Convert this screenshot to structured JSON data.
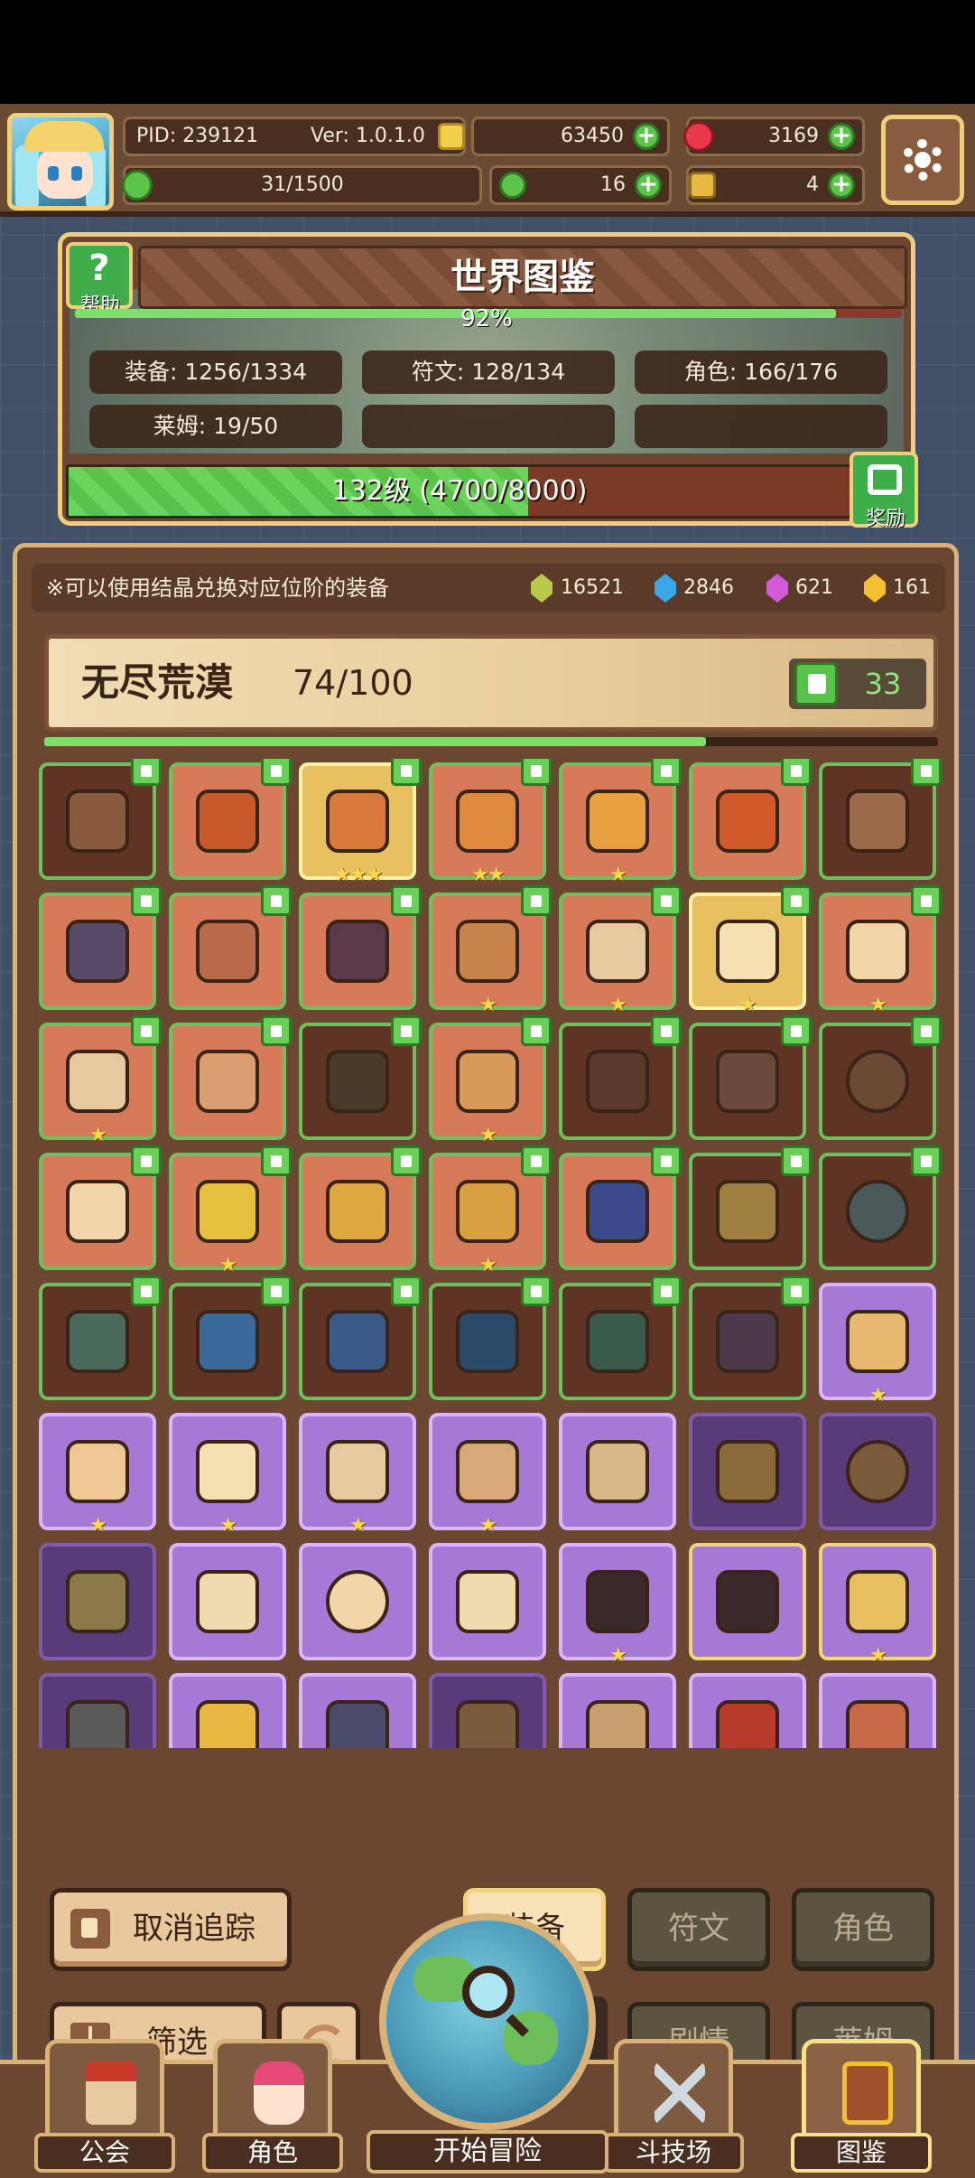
{
  "header": {
    "pid": "PID: 239121",
    "version": "Ver: 1.0.1.0",
    "gold": "63450",
    "ruby": "3169",
    "stamina": "31/1500",
    "clover": "16",
    "key": "4"
  },
  "codex": {
    "title": "世界图鉴",
    "help_label": "帮助",
    "percent_text": "92%",
    "percent_value": 0.92,
    "stats": {
      "equipment": "装备: 1256/1334",
      "runes": "符文: 128/134",
      "characters": "角色: 166/176",
      "slimes": "莱姆: 19/50"
    },
    "level_text": "132级 (4700/8000)",
    "level_progress": 0.5875,
    "reward_label": "奖励"
  },
  "main": {
    "tip": "※可以使用结晶兑换对应位阶的装备",
    "crystals": {
      "green": "16521",
      "blue": "2846",
      "purple": "621",
      "gold": "161"
    },
    "region": {
      "name": "无尽荒漠",
      "count": "74/100",
      "progress": 0.74,
      "likes": "33"
    },
    "rows": [
      [
        {
          "t": "dark",
          "c": "#8a5a3e",
          "s": "",
          "th": true
        },
        {
          "t": "orange",
          "c": "#c85a2a",
          "s": "",
          "th": true
        },
        {
          "t": "gold",
          "c": "#d87a3a",
          "s": "★★★",
          "th": true
        },
        {
          "t": "orange",
          "c": "#e08a40",
          "s": "★★",
          "th": true
        },
        {
          "t": "orange",
          "c": "#e8a040",
          "s": "★",
          "th": true
        },
        {
          "t": "orange",
          "c": "#d25a2a",
          "s": "",
          "th": true
        },
        {
          "t": "dark",
          "c": "#9a6a4a",
          "s": "",
          "th": true
        }
      ],
      [
        {
          "t": "orange",
          "c": "#5a4a6a",
          "s": "",
          "th": true
        },
        {
          "t": "orange",
          "c": "#b86a4a",
          "s": "",
          "th": true
        },
        {
          "t": "orange",
          "c": "#5a3a4a",
          "s": "",
          "th": true
        },
        {
          "t": "orange",
          "c": "#c8844a",
          "s": "★",
          "th": true
        },
        {
          "t": "orange",
          "c": "#e8caa0",
          "s": "★",
          "th": true
        },
        {
          "t": "gold",
          "c": "#f4e0b0",
          "s": "★",
          "th": true
        },
        {
          "t": "orange",
          "c": "#f0d6a8",
          "s": "★",
          "th": true
        }
      ],
      [
        {
          "t": "orange",
          "c": "#e8caa0",
          "s": "★",
          "th": true
        },
        {
          "t": "orange",
          "c": "#d8a070",
          "s": "",
          "th": true
        },
        {
          "t": "dark",
          "c": "#4a3a2a",
          "s": "",
          "th": true
        },
        {
          "t": "orange",
          "c": "#d89a5a",
          "s": "★",
          "th": true
        },
        {
          "t": "dark",
          "c": "#5a3a2a",
          "s": "",
          "th": true
        },
        {
          "t": "dark",
          "c": "#6a4a3a",
          "s": "",
          "th": true
        },
        {
          "t": "dark",
          "c": "#6a4a32",
          "s": "",
          "th": true,
          "round": true
        }
      ],
      [
        {
          "t": "orange",
          "c": "#f0d6a8",
          "s": "",
          "th": true
        },
        {
          "t": "orange",
          "c": "#e8c040",
          "s": "★",
          "th": true
        },
        {
          "t": "orange",
          "c": "#e0a840",
          "s": "",
          "th": true
        },
        {
          "t": "orange",
          "c": "#d8a040",
          "s": "★",
          "th": true
        },
        {
          "t": "orange",
          "c": "#3a4a8a",
          "s": "",
          "th": true
        },
        {
          "t": "dark",
          "c": "#a08040",
          "s": "",
          "th": true
        },
        {
          "t": "dark",
          "c": "#4a5a5a",
          "s": "",
          "th": true,
          "round": true
        }
      ],
      [
        {
          "t": "dark",
          "c": "#4a6a5a",
          "s": "",
          "th": true
        },
        {
          "t": "dark",
          "c": "#3a6a9a",
          "s": "",
          "th": true
        },
        {
          "t": "dark",
          "c": "#3a5a8a",
          "s": "",
          "th": true
        },
        {
          "t": "dark",
          "c": "#2a4a6a",
          "s": "",
          "th": true
        },
        {
          "t": "dark",
          "c": "#3a5a4a",
          "s": "",
          "th": true
        },
        {
          "t": "dark",
          "c": "#4a3a4a",
          "s": "",
          "th": true
        },
        {
          "t": "purple",
          "c": "#e8b870",
          "s": "★",
          "th": false
        }
      ],
      [
        {
          "t": "purple",
          "c": "#f0c896",
          "s": "★",
          "th": false
        },
        {
          "t": "purple",
          "c": "#f4e0b0",
          "s": "★",
          "th": false
        },
        {
          "t": "purple",
          "c": "#e8caa0",
          "s": "★",
          "th": false
        },
        {
          "t": "purple",
          "c": "#d8a878",
          "s": "★",
          "th": false
        },
        {
          "t": "purple",
          "c": "#d8b888",
          "s": "",
          "th": false
        },
        {
          "t": "dpurple",
          "c": "#8a6a3a",
          "s": "",
          "th": false
        },
        {
          "t": "dpurple",
          "c": "#7a5a3a",
          "s": "",
          "th": false,
          "round": true
        }
      ],
      [
        {
          "t": "dpurple",
          "c": "#8a7a4a",
          "s": "",
          "th": false
        },
        {
          "t": "purple",
          "c": "#f0dab0",
          "s": "",
          "th": false
        },
        {
          "t": "purple",
          "c": "#f0d6a8",
          "s": "",
          "th": false,
          "round": true
        },
        {
          "t": "purple",
          "c": "#f0dab0",
          "s": "",
          "th": false
        },
        {
          "t": "purple",
          "c": "#3a2a2a",
          "s": "★",
          "th": false
        },
        {
          "t": "goldp",
          "c": "#3a2a2a",
          "s": "",
          "th": false
        },
        {
          "t": "goldp",
          "c": "#e8c060",
          "s": "★",
          "th": false
        }
      ],
      [
        {
          "t": "dpurple",
          "c": "#5a5a5a",
          "s": "",
          "th": false
        },
        {
          "t": "purple",
          "c": "#e8b840",
          "s": "",
          "th": false
        },
        {
          "t": "purple",
          "c": "#4a4a6a",
          "s": "",
          "th": false
        },
        {
          "t": "dpurple",
          "c": "#7a5a3a",
          "s": "",
          "th": false
        },
        {
          "t": "purple",
          "c": "#c8a070",
          "s": "",
          "th": false
        },
        {
          "t": "purple",
          "c": "#b83a2a",
          "s": "",
          "th": false
        },
        {
          "t": "purple",
          "c": "#c86a4a",
          "s": "",
          "th": false
        }
      ]
    ]
  },
  "controls": {
    "untrack": "取消追踪",
    "filter": "筛选",
    "tab_equipment": "装备",
    "tab_runes": "符文",
    "tab_characters": "角色",
    "tab_story": "剧情",
    "tab_slimes": "莱姆"
  },
  "nav": {
    "guild": "公会",
    "character": "角色",
    "adventure": "开始冒险",
    "arena": "斗技场",
    "codex": "图鉴"
  }
}
